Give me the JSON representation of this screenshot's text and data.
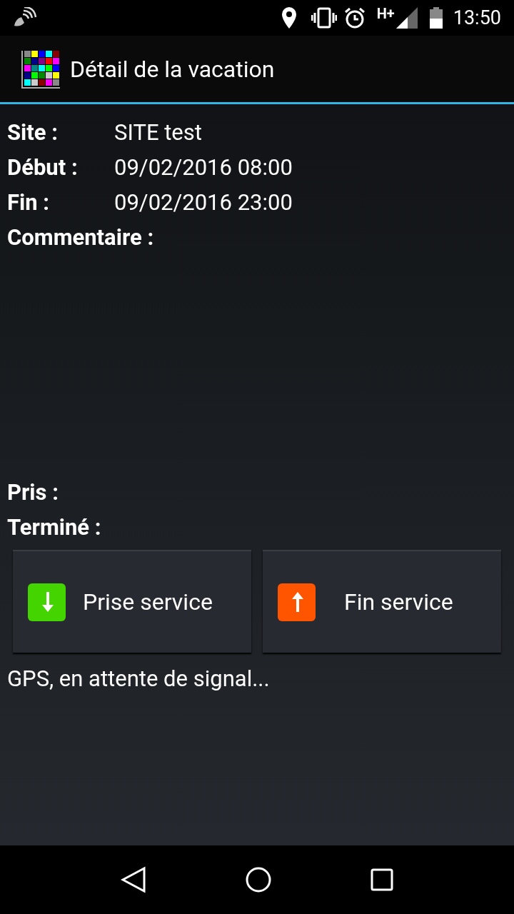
{
  "status_bar": {
    "time": "13:50",
    "network": "H+"
  },
  "app_bar": {
    "title": "Détail de la vacation"
  },
  "fields": [
    {
      "label": "Site :",
      "value": "SITE test"
    },
    {
      "label": "Début :",
      "value": "09/02/2016 08:00"
    },
    {
      "label": "Fin :",
      "value": "09/02/2016 23:00"
    },
    {
      "label": "Commentaire :"
    }
  ],
  "status_fields": [
    {
      "label": "Pris :"
    },
    {
      "label": "Terminé :"
    }
  ],
  "buttons": [
    {
      "label": "Prise service",
      "kind": "start",
      "color": "#44d400"
    },
    {
      "label": "Fin service",
      "kind": "end",
      "color": "#ff5500"
    }
  ],
  "gps_message": "GPS, en attente de signal..."
}
